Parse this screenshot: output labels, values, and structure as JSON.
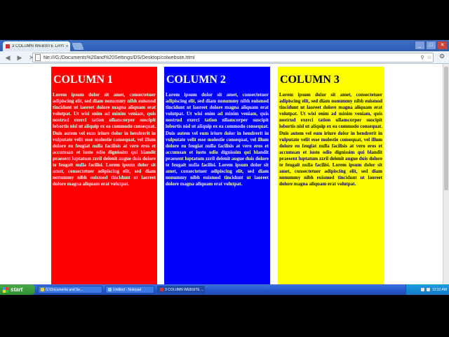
{
  "browser": {
    "tab_title": "3 COLUMN WEBSITE LAYOU",
    "tab_close": "×",
    "url": "file:///G:/Documents%20and%20Settings/DS/Desktop/colwebsite.html",
    "back_glyph": "◀",
    "forward_glyph": "▶",
    "reload_glyph": "✕",
    "zoom_glyph": "⚲",
    "star_glyph": "☆",
    "wrench_glyph": "⚙"
  },
  "window_controls": {
    "minimize": "_",
    "maximize": "□",
    "close": "✕"
  },
  "columns": [
    {
      "heading": "COLUMN 1",
      "bg": "#ff0000",
      "text": "Lorem ipsum dolor sit amet, consectetuer adipiscing elit, sed diam nonummy nibh euismod tincidunt ut laoreet dolore magna aliquam erat volutpat. Ut wisi enim ad minim veniam, quis nostrud exerci tation ullamcorper suscipit lobortis nisl ut aliquip ex ea commodo consequat. Duis autem vel eum iriure dolor in hendrerit in vulputate velit esse molestie consequat, vel illum dolore eu feugiat nulla facilisis at vero eros et accumsan et iusto odio dignissim qui blandit praesent luptatum zzril delenit augue duis dolore te feugait nulla facilisi. Lorem ipsum dolor sit amet, consectetuer adipiscing elit, sed diam nonummy nibh euismod tincidunt ut laoreet dolore magna aliquam erat volutpat."
    },
    {
      "heading": "COLUMN 2",
      "bg": "#0000ff",
      "text": "Lorem ipsum dolor sit amet, consectetuer adipiscing elit, sed diam nonummy nibh euismod tincidunt ut laoreet dolore magna aliquam erat volutpat. Ut wisi enim ad minim veniam, quis nostrud exerci tation ullamcorper suscipit lobortis nisl ut aliquip ex ea commodo consequat. Duis autem vel eum iriure dolor in hendrerit in vulputate velit esse molestie consequat, vel illum dolore eu feugiat nulla facilisis at vero eros et accumsan et iusto odio dignissim qui blandit praesent luptatum zzril delenit augue duis dolore te feugait nulla facilisi. Lorem ipsum dolor sit amet, consectetuer adipiscing elit, sed diam nonummy nibh euismod tincidunt ut laoreet dolore magna aliquam erat volutpat."
    },
    {
      "heading": "COLUMN 3",
      "bg": "#ffff00",
      "text": "Lorem ipsum dolor sit amet, consectetuer adipiscing elit, sed diam nonummy nibh euismod tincidunt ut laoreet dolore magna aliquam erat volutpat. Ut wisi enim ad minim veniam, quis nostrud exerci tation ullamcorper suscipit lobortis nisl ut aliquip ex ea commodo consequat. Duis autem vel eum iriure dolor in hendrerit in vulputate velit esse molestie consequat, vel illum dolore eu feugiat nulla facilisis at vero eros et accumsan et iusto odio dignissim qui blandit praesent luptatum zzril delenit augue duis dolore te feugait nulla facilisi. Lorem ipsum dolor sit amet, consectetuer adipiscing elit, sed diam nonummy nibh euismod tincidunt ut laoreet dolore magna aliquam erat volutpat."
    }
  ],
  "taskbar": {
    "start_label": "start",
    "tasks": [
      "G:\\Documents and Se...",
      "Untitled - Notepad",
      "3 COLUMN WEBSITE ..."
    ],
    "clock": "12:32 AM"
  }
}
